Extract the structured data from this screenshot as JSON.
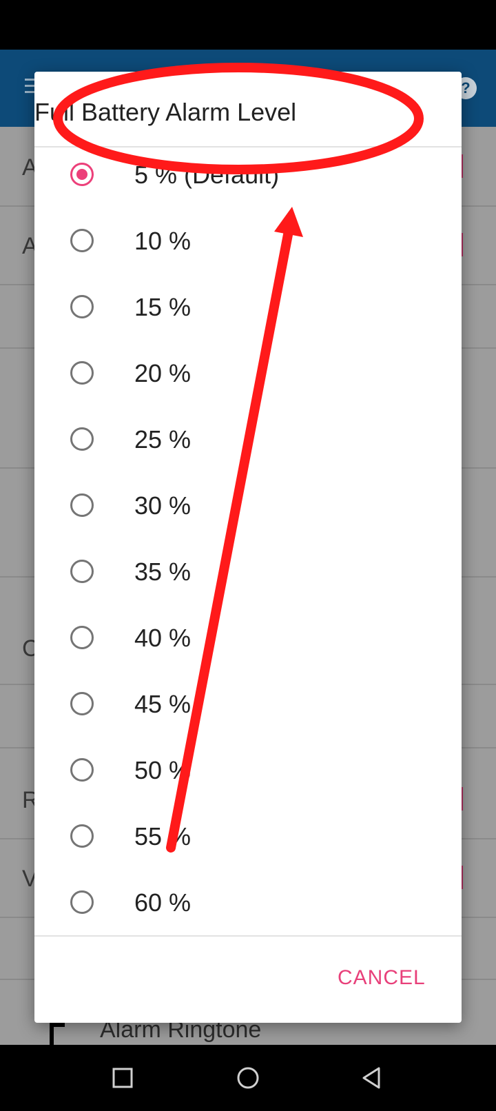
{
  "dialog": {
    "title": "Full Battery Alarm Level",
    "cancel_label": "CANCEL",
    "selected_index": 0,
    "options": [
      {
        "label": "5 % (Default)",
        "checked": true
      },
      {
        "label": "10 %",
        "checked": false
      },
      {
        "label": "15 %",
        "checked": false
      },
      {
        "label": "20 %",
        "checked": false
      },
      {
        "label": "25 %",
        "checked": false
      },
      {
        "label": "30 %",
        "checked": false
      },
      {
        "label": "35 %",
        "checked": false
      },
      {
        "label": "40 %",
        "checked": false
      },
      {
        "label": "45 %",
        "checked": false
      },
      {
        "label": "50 %",
        "checked": false
      },
      {
        "label": "55 %",
        "checked": false
      },
      {
        "label": "60 %",
        "checked": false
      }
    ]
  },
  "background": {
    "row_letters": [
      "A",
      "A",
      "",
      "",
      "",
      "C",
      "",
      "R",
      "V"
    ],
    "ringtone_label": "Alarm Ringtone"
  },
  "colors": {
    "accent": "#ec407a",
    "app_bar": "#0d4a78",
    "annotation_red": "#ff1a1a"
  },
  "icons": {
    "menu": "hamburger-menu-icon",
    "help": "help-icon",
    "nav_back": "square-recents-icon",
    "nav_home": "circle-home-icon",
    "nav_recent": "triangle-back-icon"
  }
}
